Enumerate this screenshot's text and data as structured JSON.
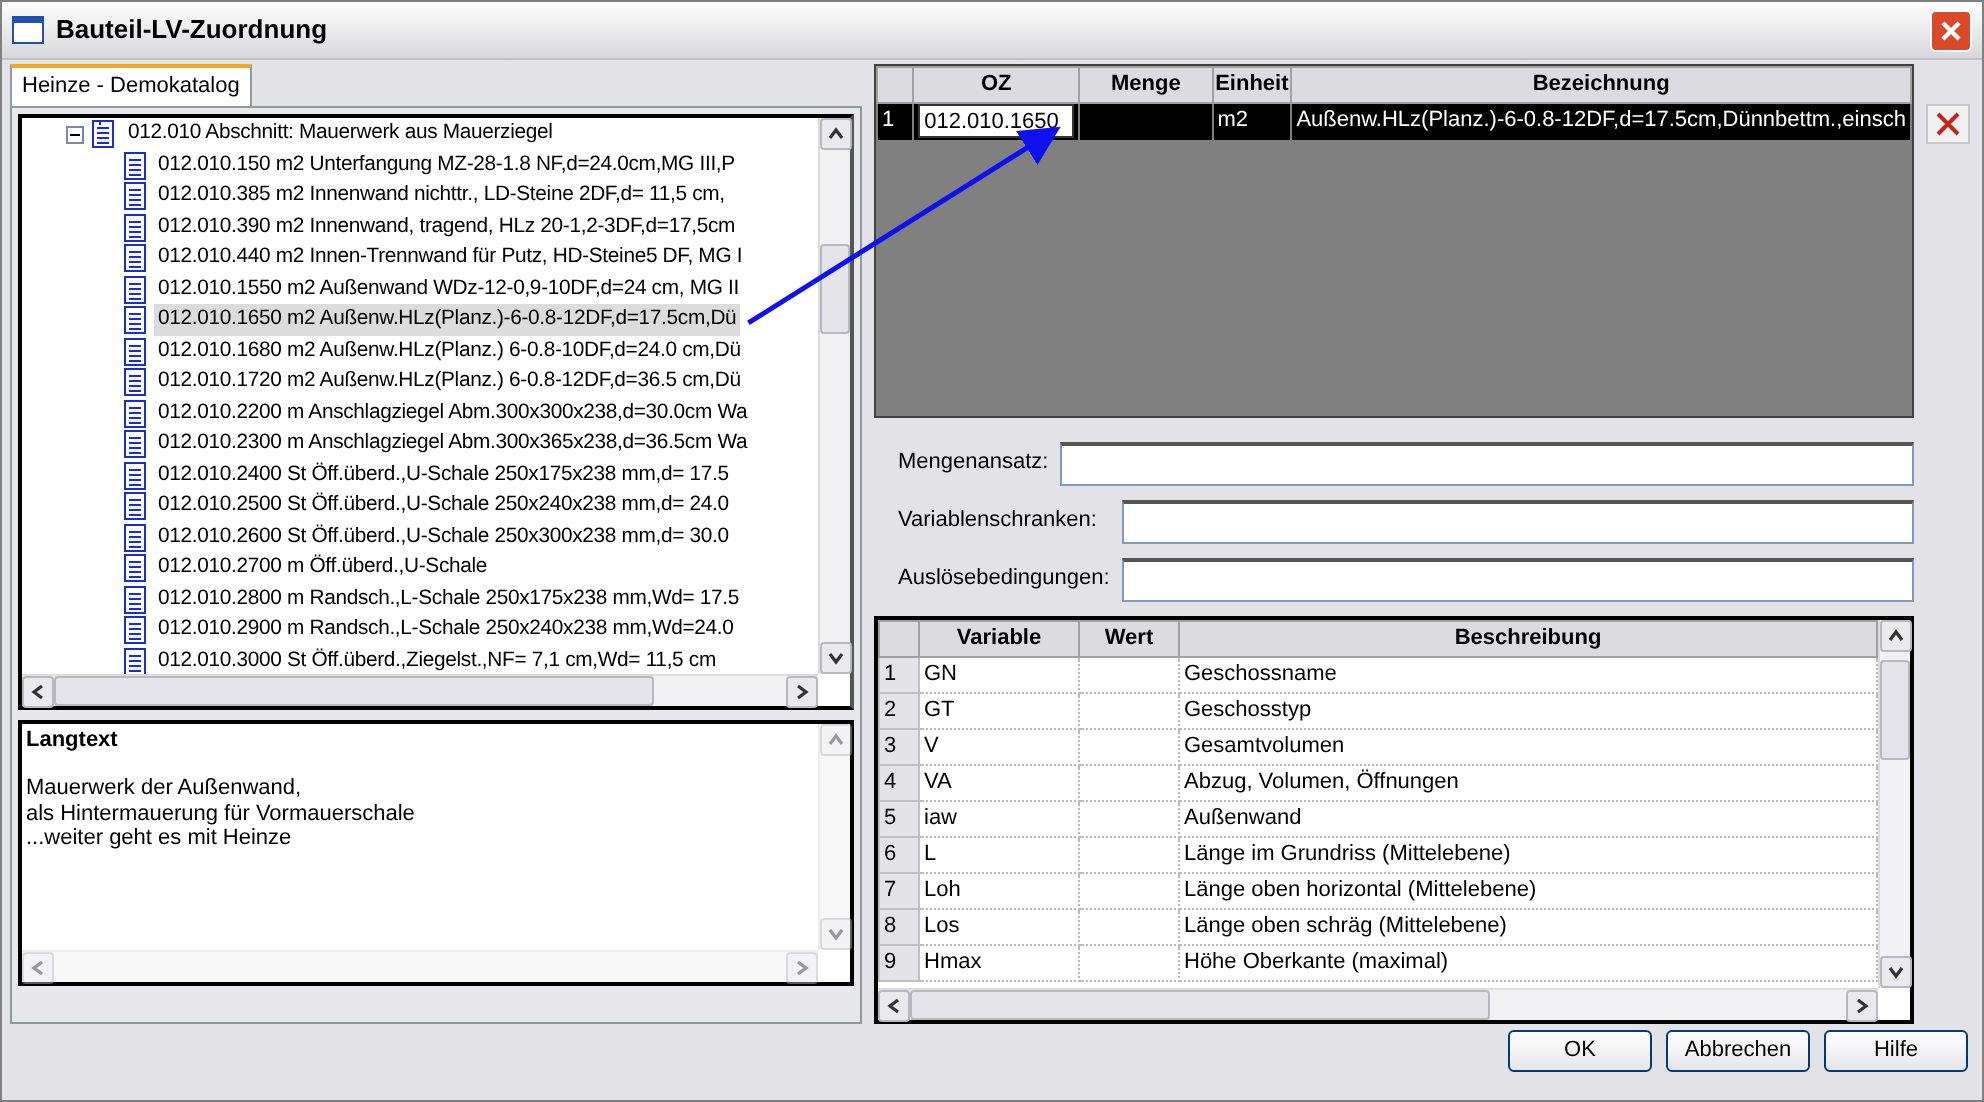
{
  "window": {
    "title": "Bauteil-LV-Zuordnung"
  },
  "tabs": [
    {
      "label": "Heinze - Demokatalog",
      "selected": true
    }
  ],
  "tree": {
    "items": [
      {
        "label": "012.010 Abschnitt: Mauerwerk aus Mauerziegel",
        "expanded": true,
        "children": [
          {
            "label": "012.010.150 m2 Unterfangung MZ-28-1.8 NF,d=24.0cm,MG III,P",
            "selected": false
          },
          {
            "label": "012.010.385 m2 Innenwand nichttr., LD-Steine 2DF,d= 11,5 cm,",
            "selected": false
          },
          {
            "label": "012.010.390 m2 Innenwand, tragend, HLz 20-1,2-3DF,d=17,5cm",
            "selected": false
          },
          {
            "label": "012.010.440 m2 Innen-Trennwand für Putz, HD-Steine5 DF, MG I",
            "selected": false
          },
          {
            "label": "012.010.1550 m2 Außenwand WDz-12-0,9-10DF,d=24 cm, MG II",
            "selected": false
          },
          {
            "label": "012.010.1650 m2 Außenw.HLz(Planz.)-6-0.8-12DF,d=17.5cm,Dü",
            "selected": true
          },
          {
            "label": "012.010.1680 m2 Außenw.HLz(Planz.) 6-0.8-10DF,d=24.0 cm,Dü",
            "selected": false
          },
          {
            "label": "012.010.1720 m2 Außenw.HLz(Planz.) 6-0.8-12DF,d=36.5 cm,Dü",
            "selected": false
          },
          {
            "label": "012.010.2200 m Anschlagziegel Abm.300x300x238,d=30.0cm Wa",
            "selected": false
          },
          {
            "label": "012.010.2300 m Anschlagziegel Abm.300x365x238,d=36.5cm Wa",
            "selected": false
          },
          {
            "label": "012.010.2400 St Öff.überd.,U-Schale 250x175x238 mm,d= 17.5",
            "selected": false
          },
          {
            "label": "012.010.2500 St Öff.überd.,U-Schale 250x240x238 mm,d= 24.0",
            "selected": false
          },
          {
            "label": "012.010.2600 St Öff.überd.,U-Schale 250x300x238 mm,d= 30.0",
            "selected": false
          },
          {
            "label": "012.010.2700 m Öff.überd.,U-Schale",
            "selected": false
          },
          {
            "label": "012.010.2800 m Randsch.,L-Schale 250x175x238 mm,Wd= 17.5",
            "selected": false
          },
          {
            "label": "012.010.2900 m Randsch.,L-Schale 250x240x238 mm,Wd=24.0",
            "selected": false
          },
          {
            "label": "012.010.3000 St Öff.überd.,Ziegelst.,NF= 7,1 cm,Wd= 11,5 cm",
            "selected": false
          }
        ]
      }
    ]
  },
  "langtext": {
    "title": "Langtext",
    "lines": [
      "Mauerwerk der Außenwand,",
      "als Hintermauerung für Vormauerschale",
      "...weiter geht es mit Heinze"
    ]
  },
  "assignment_table": {
    "columns": [
      "OZ",
      "Menge",
      "Einheit",
      "Bezeichnung"
    ],
    "rows": [
      {
        "number": "1",
        "oz": "012.010.1650",
        "unit": "m2",
        "description": "Außenw.HLz(Planz.)-6-0.8-12DF,d=17.5cm,Dünnbettm.,einsch",
        "selected": true
      }
    ]
  },
  "fields": [
    {
      "label": "Mengenansatz:"
    },
    {
      "label": "Variablenschranken:"
    },
    {
      "label": "Auslösebedingungen:"
    }
  ],
  "variables_table": {
    "columns": [
      "Variable",
      "Wert",
      "Beschreibung"
    ],
    "rows": [
      {
        "number": "1",
        "variable": "GN",
        "description": "Geschossname"
      },
      {
        "number": "2",
        "variable": "GT",
        "description": "Geschosstyp"
      },
      {
        "number": "3",
        "variable": "V",
        "description": "Gesamtvolumen"
      },
      {
        "number": "4",
        "variable": "VA",
        "description": "Abzug, Volumen, Öffnungen"
      },
      {
        "number": "5",
        "variable": "iaw",
        "description": "Außenwand"
      },
      {
        "number": "6",
        "variable": "L",
        "description": "Länge im Grundriss (Mittelebene)"
      },
      {
        "number": "7",
        "variable": "Loh",
        "description": "Länge oben horizontal (Mittelebene)"
      },
      {
        "number": "8",
        "variable": "Los",
        "description": "Länge oben schräg (Mittelebene)"
      },
      {
        "number": "9",
        "variable": "Hmax",
        "description": "Höhe Oberkante (maximal)"
      }
    ]
  },
  "buttons": [
    "OK",
    "Abbrechen",
    "Hilfe"
  ]
}
